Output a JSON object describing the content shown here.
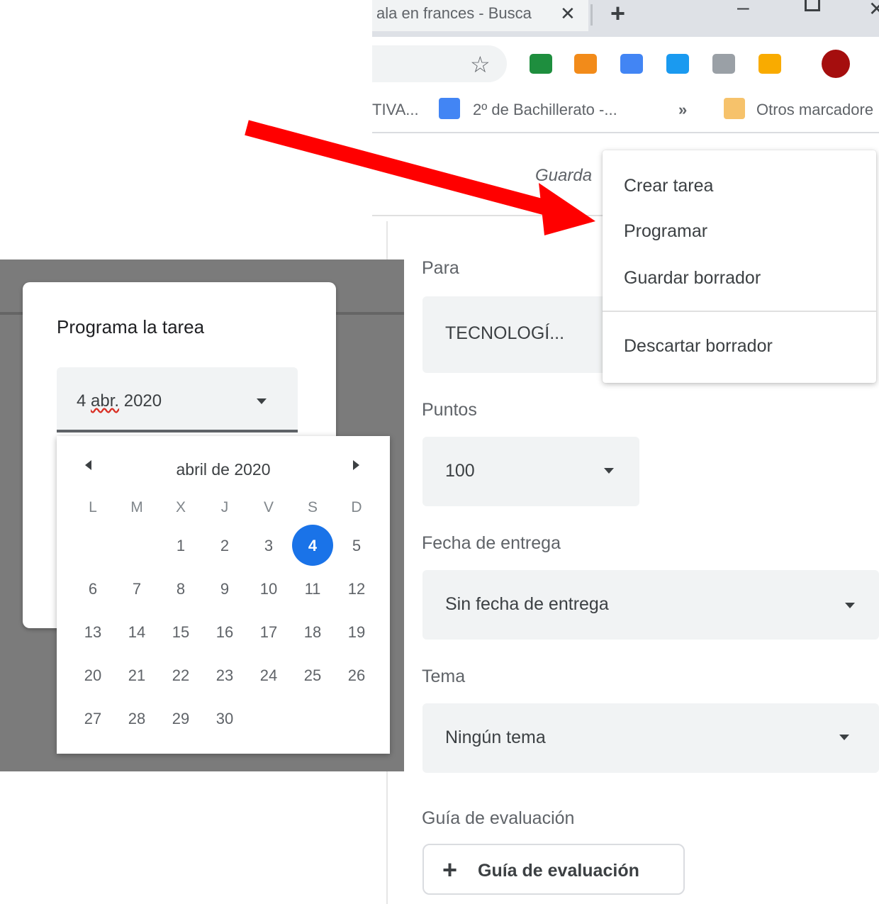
{
  "browser": {
    "tab_title": "ala en frances - Busca",
    "close_glyph": "✕",
    "new_tab_glyph": "+",
    "minimize_glyph": "–",
    "window_close_glyph": "✕",
    "star_glyph": "☆",
    "extensions": [
      {
        "name": "meet-extension-icon",
        "color": "#1e8e3e"
      },
      {
        "name": "briefcase-extension-icon",
        "color": "#f28b1a"
      },
      {
        "name": "pen-extension-icon",
        "color": "#4285f4"
      },
      {
        "name": "diamond-extension-icon",
        "color": "#1a9af0"
      },
      {
        "name": "grid-extension-icon",
        "color": "#9aa0a6"
      },
      {
        "name": "hand-extension-icon",
        "color": "#f9ab00"
      },
      {
        "name": "profile-avatar-icon",
        "color": "#a50e0e"
      }
    ],
    "bookmarks": [
      {
        "label": "TIVA..."
      },
      {
        "label": "2º de Bachillerato -..."
      },
      {
        "label": "»"
      },
      {
        "label": "Otros marcadore"
      }
    ]
  },
  "page": {
    "saved_label": "Guarda",
    "fields": {
      "para": {
        "label": "Para",
        "value": "TECNOLOGÍ..."
      },
      "puntos": {
        "label": "Puntos",
        "value": "100"
      },
      "fecha": {
        "label": "Fecha de entrega",
        "value": "Sin fecha de entrega"
      },
      "tema": {
        "label": "Tema",
        "value": "Ningún tema"
      },
      "guia": {
        "label": "Guía de evaluación"
      }
    },
    "rubric_button": {
      "plus": "+",
      "label": "Guía de evaluación"
    }
  },
  "menu": {
    "items": [
      "Crear tarea",
      "Programar",
      "Guardar borrador",
      "Descartar borrador"
    ]
  },
  "dialog": {
    "title": "Programa la tarea",
    "date_day": "4",
    "date_month": "abr.",
    "date_year": "2020"
  },
  "calendar": {
    "month_label": "abril de 2020",
    "weekdays": [
      "L",
      "M",
      "X",
      "J",
      "V",
      "S",
      "D"
    ],
    "weeks": [
      [
        "",
        "",
        "1",
        "2",
        "3",
        "4",
        "5"
      ],
      [
        "6",
        "7",
        "8",
        "9",
        "10",
        "11",
        "12"
      ],
      [
        "13",
        "14",
        "15",
        "16",
        "17",
        "18",
        "19"
      ],
      [
        "20",
        "21",
        "22",
        "23",
        "24",
        "25",
        "26"
      ],
      [
        "27",
        "28",
        "29",
        "30",
        "",
        "",
        ""
      ]
    ],
    "selected_day": "4",
    "accent_color": "#1a73e8"
  },
  "annotation": {
    "arrow_color": "#ff0000"
  }
}
